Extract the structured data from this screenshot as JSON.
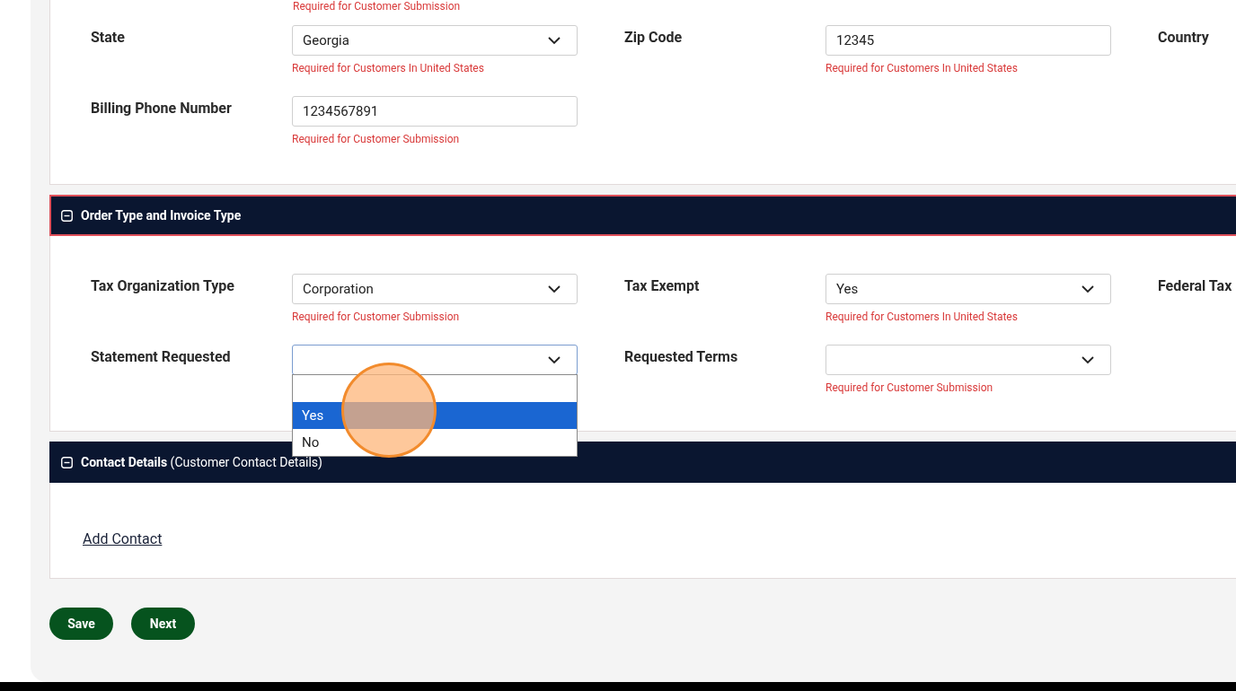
{
  "top_hint": "Required for Customer Submission",
  "sections": [
    {
      "kind": "body",
      "rows": [
        [
          {
            "label": "State",
            "field": {
              "kind": "select",
              "value": "Georgia",
              "hint": "Required for Customers In United States"
            }
          },
          {
            "label": "Zip Code",
            "field": {
              "kind": "text",
              "value": "12345",
              "hint": "Required for Customers In United States"
            }
          },
          {
            "label": "Country"
          }
        ],
        [
          {
            "label": "Billing Phone Number",
            "field": {
              "kind": "text",
              "value": "1234567891",
              "hint": "Required for Customer Submission"
            }
          }
        ]
      ]
    },
    {
      "kind": "panel",
      "title": "Order Type and Invoice Type",
      "highlighted": true,
      "expanded": true,
      "rows": [
        [
          {
            "label": "Tax Organization Type",
            "field": {
              "kind": "select",
              "value": "Corporation",
              "hint": "Required for Customer Submission"
            }
          },
          {
            "label": "Tax Exempt",
            "field": {
              "kind": "select",
              "value": "Yes",
              "hint": "Required for Customers In United States"
            }
          },
          {
            "label": "Federal Tax"
          }
        ],
        [
          {
            "label": "Statement Requested",
            "field": {
              "kind": "select",
              "focused": true,
              "open": true,
              "options": [
                {
                  "kind": "blank",
                  "selected": false
                },
                {
                  "kind": "option",
                  "label": "Yes",
                  "selected": true
                },
                {
                  "kind": "option",
                  "label": "No",
                  "selected": false
                }
              ]
            }
          },
          {
            "label": "Requested Terms",
            "field": {
              "kind": "select",
              "hint": "Required for Customer Submission"
            }
          }
        ]
      ]
    },
    {
      "kind": "panel",
      "title": "Contact Details",
      "subtitle": "(Customer Contact Details)",
      "highlighted": false,
      "expanded": true,
      "link": "Add Contact"
    }
  ],
  "buttons": [
    "Save",
    "Next"
  ]
}
